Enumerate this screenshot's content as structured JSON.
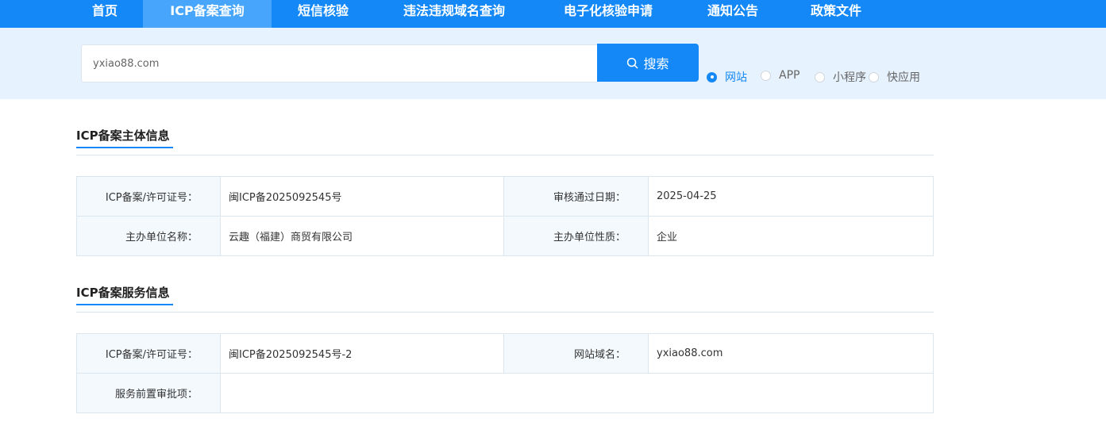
{
  "nav": {
    "items": [
      {
        "label": "首页"
      },
      {
        "label": "ICP备案查询"
      },
      {
        "label": "短信核验"
      },
      {
        "label": "违法违规域名查询"
      },
      {
        "label": "电子化核验申请"
      },
      {
        "label": "通知公告"
      },
      {
        "label": "政策文件"
      }
    ],
    "active": "ICP备案查询"
  },
  "search": {
    "value": "yxiao88.com",
    "button_label": "搜索",
    "types": [
      {
        "label": "网站",
        "checked": true
      },
      {
        "label": "APP",
        "checked": false
      },
      {
        "label": "小程序",
        "checked": false
      },
      {
        "label": "快应用",
        "checked": false
      }
    ]
  },
  "subject": {
    "title": "ICP备案主体信息",
    "license_label": "ICP备案/许可证号：",
    "license_value": "闽ICP备2025092545号",
    "approve_date_label": "审核通过日期：",
    "approve_date_value": "2025-04-25",
    "org_name_label": "主办单位名称：",
    "org_name_value": "云趣（福建）商贸有限公司",
    "org_type_label": "主办单位性质：",
    "org_type_value": "企业"
  },
  "service": {
    "title": "ICP备案服务信息",
    "license_label": "ICP备案/许可证号：",
    "license_value": "闽ICP备2025092545号-2",
    "domain_label": "网站域名：",
    "domain_value": "yxiao88.com",
    "preapproval_label": "服务前置审批项：",
    "preapproval_value": ""
  },
  "colors": {
    "primary": "#1488f6",
    "nav_active": "#47a6fb",
    "band": "#e6f2fd",
    "label_bg": "#f4f9fd"
  }
}
